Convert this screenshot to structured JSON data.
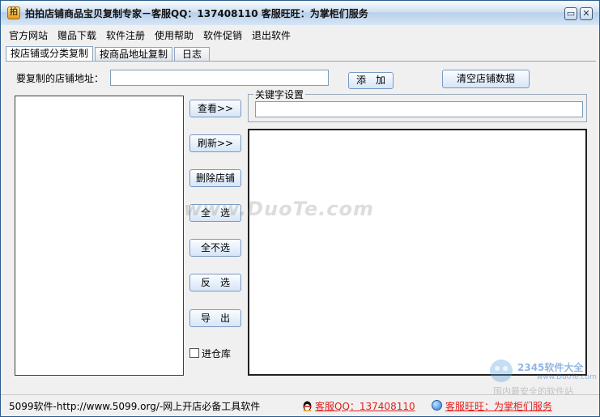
{
  "window": {
    "title": "拍拍店铺商品宝贝复制专家－客服QQ：137408110 客服旺旺：为掌柜们服务",
    "icon": "app-logo-icon",
    "minimize_label": "▭",
    "close_label": "✕"
  },
  "menu": {
    "items": [
      "官方网站",
      "赠品下载",
      "软件注册",
      "使用帮助",
      "软件促销",
      "退出软件"
    ]
  },
  "tabs": [
    {
      "label": "按店铺或分类复制",
      "active": true
    },
    {
      "label": "按商品地址复制",
      "active": false
    },
    {
      "label": "日志",
      "active": false
    }
  ],
  "form": {
    "shop_url_label": "要复制的店铺地址：",
    "shop_url_value": "",
    "add_button": "添　加",
    "clear_button": "清空店铺数据",
    "keyword_group_label": "关键字设置",
    "keyword_value": ""
  },
  "actions": {
    "view": "查看>>",
    "refresh": "刷新>>",
    "delete_shop": "删除店铺",
    "select_all": "全　选",
    "select_none": "全不选",
    "invert": "反　选",
    "export": "导　出",
    "warehouse_label": "进仓库",
    "warehouse_checked": false
  },
  "status": {
    "left_text": "5099软件-http://www.5099.org/-网上开店必备工具软件",
    "qq_link": "客服QQ：137408110",
    "wangwang_link": "客服旺旺：为掌柜们服务"
  },
  "watermark": {
    "center": "www.DuoTe.com",
    "corner_logo": "2345软件大全",
    "corner_url": "www.DuoTe.com",
    "corner_sub": "国内最安全的软件站"
  },
  "colors": {
    "link": "#e0201c",
    "title_bar": "#cfe0f3",
    "button_border": "#7a99c1"
  }
}
